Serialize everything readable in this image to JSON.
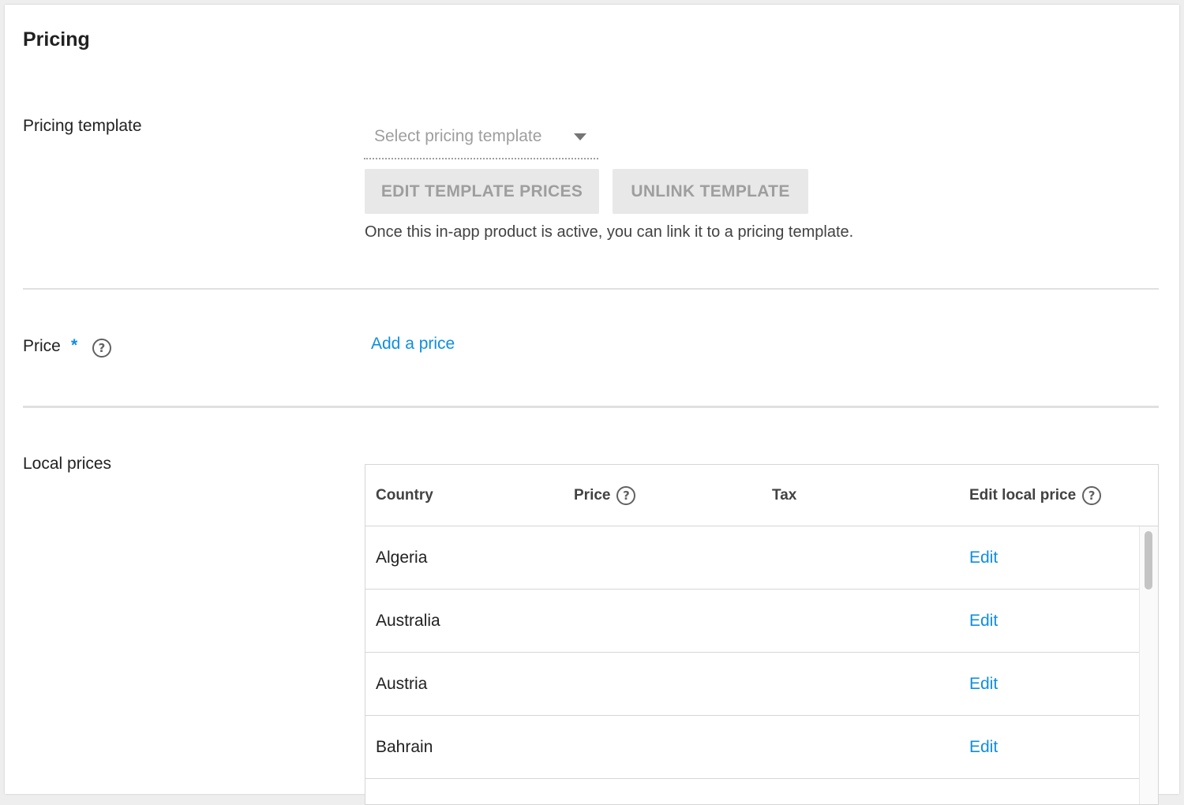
{
  "card": {
    "title": "Pricing"
  },
  "pricing_template": {
    "label": "Pricing template",
    "select_placeholder": "Select pricing template",
    "edit_button": "EDIT TEMPLATE PRICES",
    "unlink_button": "UNLINK TEMPLATE",
    "hint": "Once this in-app product is active, you can link it to a pricing template."
  },
  "price": {
    "label": "Price",
    "required_mark": "*",
    "help_icon": "help-circle-icon",
    "add_link": "Add a price"
  },
  "local_prices": {
    "label": "Local prices",
    "columns": {
      "country": "Country",
      "price": "Price",
      "tax": "Tax",
      "edit": "Edit local price"
    },
    "rows": [
      {
        "country": "Algeria",
        "action": "Edit"
      },
      {
        "country": "Australia",
        "action": "Edit"
      },
      {
        "country": "Austria",
        "action": "Edit"
      },
      {
        "country": "Bahrain",
        "action": "Edit"
      },
      {
        "country": "",
        "action": ""
      }
    ]
  },
  "colors": {
    "link": "#0e8ee0",
    "disabled_button_bg": "#e8e8e8",
    "disabled_text": "#9e9e9e"
  }
}
